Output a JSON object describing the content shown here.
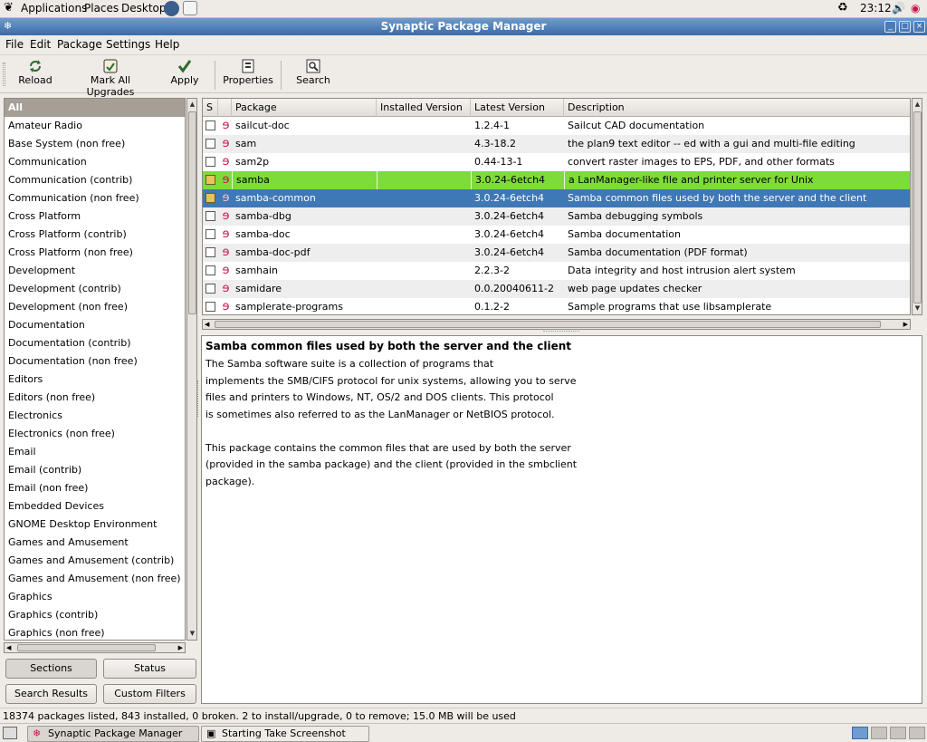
{
  "top_panel": {
    "menus": [
      "Applications",
      "Places",
      "Desktop"
    ],
    "clock": "23:12"
  },
  "window": {
    "title": "Synaptic Package Manager"
  },
  "menubar": [
    "File",
    "Edit",
    "Package",
    "Settings",
    "Help"
  ],
  "toolbar": {
    "reload": "Reload",
    "mark_all_upgrades": "Mark All Upgrades",
    "apply": "Apply",
    "properties": "Properties",
    "search": "Search"
  },
  "sections": [
    "All",
    "Amateur Radio",
    "Base System (non free)",
    "Communication",
    "Communication (contrib)",
    "Communication (non free)",
    "Cross Platform",
    "Cross Platform (contrib)",
    "Cross Platform (non free)",
    "Development",
    "Development (contrib)",
    "Development (non free)",
    "Documentation",
    "Documentation (contrib)",
    "Documentation (non free)",
    "Editors",
    "Editors (non free)",
    "Electronics",
    "Electronics (non free)",
    "Email",
    "Email (contrib)",
    "Email (non free)",
    "Embedded Devices",
    "GNOME Desktop Environment",
    "Games and Amusement",
    "Games and Amusement (contrib)",
    "Games and Amusement (non free)",
    "Graphics",
    "Graphics (contrib)",
    "Graphics (non free)"
  ],
  "filter_buttons": {
    "sections": "Sections",
    "status": "Status",
    "search_results": "Search Results",
    "custom_filters": "Custom Filters"
  },
  "table": {
    "columns": [
      "S",
      "Package",
      "Installed Version",
      "Latest Version",
      "Description"
    ],
    "rows": [
      {
        "name": "sailcut-doc",
        "installed": "",
        "latest": "1.2.4-1",
        "description": "Sailcut CAD documentation",
        "state": "none"
      },
      {
        "name": "sam",
        "installed": "",
        "latest": "4.3-18.2",
        "description": "the plan9 text editor -- ed with a gui and multi-file editing",
        "state": "none"
      },
      {
        "name": "sam2p",
        "installed": "",
        "latest": "0.44-13-1",
        "description": "convert raster images to EPS, PDF, and other formats",
        "state": "none"
      },
      {
        "name": "samba",
        "installed": "",
        "latest": "3.0.24-6etch4",
        "description": "a LanManager-like file and printer server for Unix",
        "state": "install"
      },
      {
        "name": "samba-common",
        "installed": "",
        "latest": "3.0.24-6etch4",
        "description": "Samba common files used by both the server and the client",
        "state": "install"
      },
      {
        "name": "samba-dbg",
        "installed": "",
        "latest": "3.0.24-6etch4",
        "description": "Samba debugging symbols",
        "state": "none"
      },
      {
        "name": "samba-doc",
        "installed": "",
        "latest": "3.0.24-6etch4",
        "description": "Samba documentation",
        "state": "none"
      },
      {
        "name": "samba-doc-pdf",
        "installed": "",
        "latest": "3.0.24-6etch4",
        "description": "Samba documentation (PDF format)",
        "state": "none"
      },
      {
        "name": "samhain",
        "installed": "",
        "latest": "2.2.3-2",
        "description": "Data integrity and host intrusion alert system",
        "state": "none"
      },
      {
        "name": "samidare",
        "installed": "",
        "latest": "0.0.20040611-2",
        "description": "web page updates checker",
        "state": "none"
      },
      {
        "name": "samplerate-programs",
        "installed": "",
        "latest": "0.1.2-2",
        "description": "Sample programs that use libsamplerate",
        "state": "none"
      }
    ]
  },
  "description": {
    "title": "Samba common files used by both the server and the client",
    "lines": [
      "The Samba software suite is a collection of programs that",
      "implements the SMB/CIFS protocol for unix systems, allowing you to serve",
      "files and printers to Windows, NT, OS/2 and DOS clients. This protocol",
      "is sometimes also referred to as the LanManager or NetBIOS protocol.",
      "",
      "This package contains the common files that are used by both the server",
      "(provided in the samba package) and the client (provided in the smbclient",
      "package)."
    ]
  },
  "status_bar": "18374 packages listed, 843 installed, 0 broken. 2 to install/upgrade, 0 to remove; 15.0 MB will be used",
  "taskbar": {
    "tasks": [
      "Synaptic Package Manager",
      "Starting Take Screenshot"
    ]
  },
  "colors": {
    "title_bar": "#3a6aa6",
    "selected_row": "#3f78b6",
    "marked_row": "#7ddb3a",
    "section_selected": "#a69f95"
  }
}
